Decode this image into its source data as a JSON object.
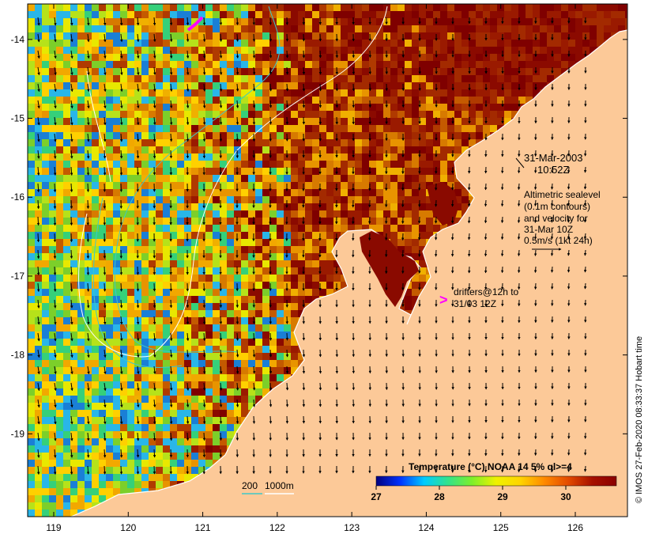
{
  "map": {
    "lon_range": [
      118.65,
      126.7
    ],
    "lat_range": [
      -20.05,
      -13.55
    ],
    "lon_ticks": [
      {
        "value": 119,
        "label": "119"
      },
      {
        "value": 120,
        "label": "120"
      },
      {
        "value": 121,
        "label": "121"
      },
      {
        "value": 122,
        "label": "122"
      },
      {
        "value": 123,
        "label": "123"
      },
      {
        "value": 124,
        "label": "124"
      },
      {
        "value": 125,
        "label": "125"
      },
      {
        "value": 126,
        "label": "126"
      }
    ],
    "lat_ticks": [
      {
        "value": -14,
        "label": "-14"
      },
      {
        "value": -15,
        "label": "-15"
      },
      {
        "value": -16,
        "label": "-16"
      },
      {
        "value": -17,
        "label": "-17"
      },
      {
        "value": -18,
        "label": "-18"
      },
      {
        "value": -19,
        "label": "-19"
      }
    ],
    "colors": {
      "land": "#fcc998",
      "coastline": "#ffffff",
      "contour_200m": "#3fc8c8",
      "contour_1000m": "#ffffff",
      "drifter": "#ff00ff",
      "arrow": "#000000"
    }
  },
  "annotations": {
    "date": "31-Mar-2003",
    "time": "10:52Z",
    "altimetry_lines": [
      "Altimetric sealevel",
      "(0.1m contours)",
      "and velocity for",
      "31-Mar 10Z",
      "0.5m/s (1kt 24h)"
    ],
    "drifters_lines": [
      "drifters@12h to",
      "31/03 12Z"
    ],
    "drifter_symbol": ">"
  },
  "contour_legend": {
    "label_200": "200",
    "label_1000": "1000m"
  },
  "colorbar": {
    "title": "Temperature (°C) NOAA 14 5% ql>=4",
    "range": [
      27,
      30.8
    ],
    "ticks": [
      {
        "value": 27,
        "label": "27"
      },
      {
        "value": 28,
        "label": "28"
      },
      {
        "value": 29,
        "label": "29"
      },
      {
        "value": 30,
        "label": "30"
      }
    ],
    "stops": [
      "#00007f",
      "#0033ff",
      "#00ccff",
      "#33e38a",
      "#7fef2a",
      "#eff200",
      "#ffd400",
      "#ff8a00",
      "#e34a00",
      "#a61000",
      "#8b0000"
    ]
  },
  "credit": "© IMOS 27-Feb-2020 08:33:37 Hobart time"
}
